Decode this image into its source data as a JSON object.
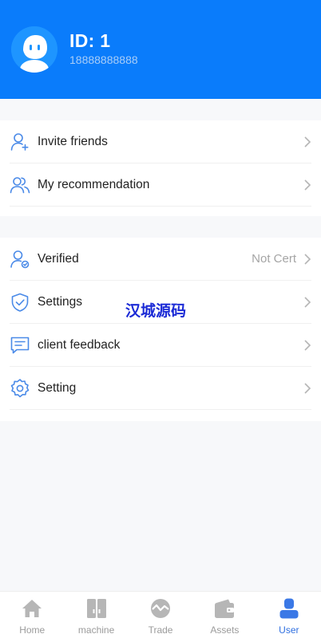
{
  "profile": {
    "id_label": "ID: 1",
    "phone": "18888888888",
    "avatar_icon": "robot-avatar-icon"
  },
  "group1": [
    {
      "label": "Invite friends",
      "icon": "user-plus-icon",
      "value": ""
    },
    {
      "label": "My recommendation",
      "icon": "users-icon",
      "value": ""
    }
  ],
  "group2": [
    {
      "label": "Verified",
      "icon": "user-verify-icon",
      "value": "Not Cert"
    },
    {
      "label": "Settings",
      "icon": "shield-check-icon",
      "value": ""
    },
    {
      "label": "client feedback",
      "icon": "message-icon",
      "value": ""
    },
    {
      "label": "Setting",
      "icon": "gear-icon",
      "value": ""
    }
  ],
  "watermark": "汉城源码",
  "tabbar": [
    {
      "label": "Home",
      "icon": "home-icon",
      "active": false
    },
    {
      "label": "machine",
      "icon": "machine-icon",
      "active": false
    },
    {
      "label": "Trade",
      "icon": "trade-icon",
      "active": false
    },
    {
      "label": "Assets",
      "icon": "wallet-icon",
      "active": false
    },
    {
      "label": "User",
      "icon": "user-icon",
      "active": true
    }
  ],
  "colors": {
    "header_bg": "#0a7cfb",
    "accent": "#2f6fe0",
    "icon_blue": "#4a8ae8",
    "tab_inactive": "#9b9b9b"
  }
}
